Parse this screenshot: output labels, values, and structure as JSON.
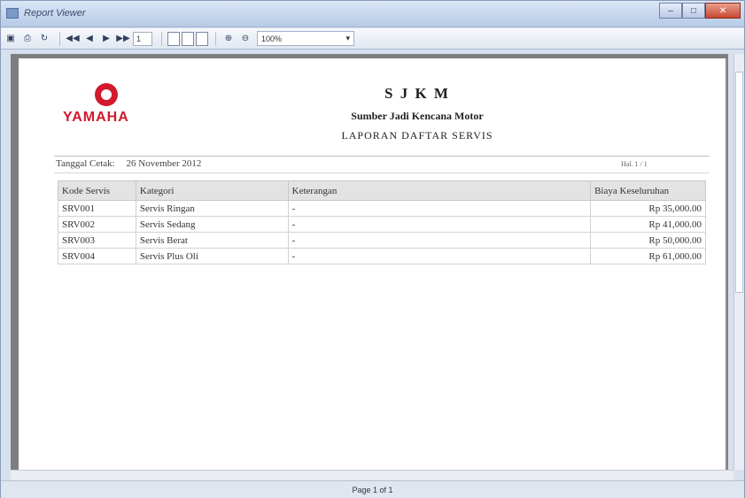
{
  "window": {
    "title": "Report Viewer"
  },
  "toolbar": {
    "page_input": "1",
    "zoom_value": "100%"
  },
  "report": {
    "company_code": "S J K M",
    "company_name": "Sumber Jadi Kencana Motor",
    "report_title": "LAPORAN DAFTAR SERVIS",
    "logo_text": "YAMAHA",
    "print_date_label": "Tanggal Cetak:",
    "print_date_value": "26 November 2012",
    "page_indicator": "Hal. 1 / 1",
    "columns": [
      "Kode Servis",
      "Kategori",
      "Keterangan",
      "Biaya Keseluruhan"
    ],
    "rows": [
      [
        "SRV001",
        "Servis Ringan",
        "-",
        "Rp  35,000.00"
      ],
      [
        "SRV002",
        "Servis Sedang",
        "-",
        "Rp  41,000.00"
      ],
      [
        "SRV003",
        "Servis Berat",
        "-",
        "Rp  50,000.00"
      ],
      [
        "SRV004",
        "Servis Plus Oli",
        "-",
        "Rp  61,000.00"
      ]
    ]
  },
  "status": {
    "page_text": "Page 1 of 1"
  },
  "icons": {
    "title": "report-viewer-icon",
    "toolbar": [
      "save-icon",
      "print-icon",
      "refresh-icon",
      "first-page-icon",
      "previous-page-icon",
      "next-page-icon",
      "last-page-icon",
      "single-page-icon",
      "two-page-icon",
      "multi-page-icon",
      "zoom-in-icon",
      "zoom-out-icon"
    ]
  },
  "colors": {
    "brand": "#d3192c"
  }
}
